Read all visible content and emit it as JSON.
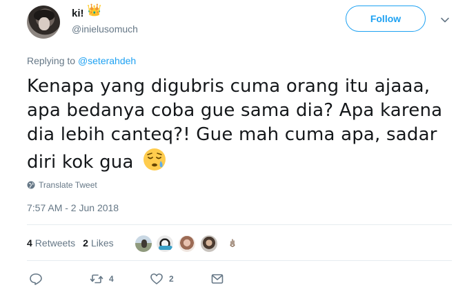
{
  "user": {
    "display_name": "ki!",
    "handle": "@inielusomuch",
    "crown": "👑"
  },
  "follow_label": "Follow",
  "reply_context": {
    "prefix": "Replying to",
    "mention": "@seterahdeh"
  },
  "tweet": {
    "text": "Kenapa yang digubris cuma orang itu ajaaa, apa bedanya coba gue sama dia? Apa karena dia lebih canteq?! Gue mah cuma apa, sadar diri kok gua",
    "emoji": "sleepy-face-emoji"
  },
  "translate_label": "Translate Tweet",
  "timestamp": "7:57 AM - 2 Jun 2018",
  "stats": {
    "retweets_count": "4",
    "retweets_label": "Retweets",
    "likes_count": "2",
    "likes_label": "Likes"
  },
  "actions": {
    "reply_icon": "reply-icon",
    "retweet_count": "4",
    "like_count": "2"
  },
  "colors": {
    "accent": "#1da1f2",
    "muted": "#657786",
    "divider": "#e6ecf0"
  }
}
